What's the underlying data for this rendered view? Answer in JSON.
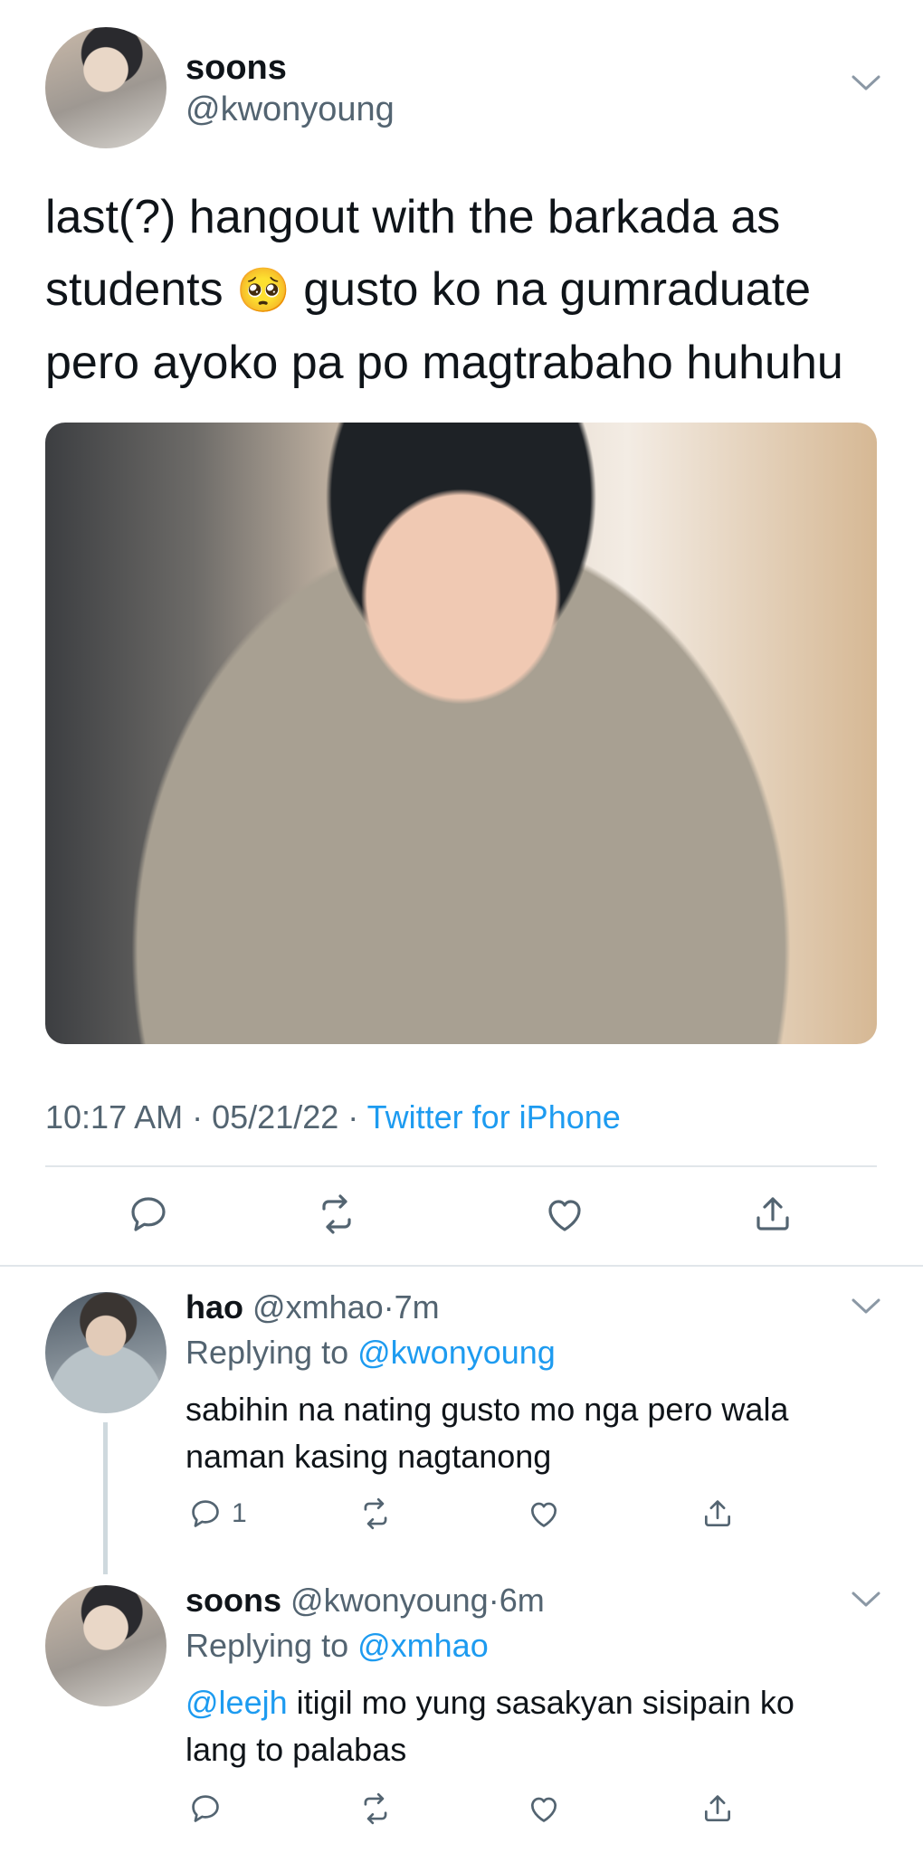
{
  "main_tweet": {
    "display_name": "soons",
    "handle": "@kwonyoung",
    "text_line1": "last(?) hangout with the barkada as",
    "text_line2_a": "students",
    "text_line2_emoji": "🥺",
    "text_line2_b": "gusto ko na gumraduate",
    "text_line3": "pero ayoko pa po magtrabaho huhuhu",
    "time": "10:17 AM",
    "date": "05/21/22",
    "separator": "·",
    "source": "Twitter for iPhone"
  },
  "replies": [
    {
      "display_name": "hao",
      "handle": "@xmhao",
      "dot": "·",
      "time": "7m",
      "replying_prefix": "Replying to",
      "replying_to": "@kwonyoung",
      "mention": "",
      "text_line1": "sabihin na nating gusto mo nga pero wala",
      "text_line2": "naman kasing nagtanong",
      "reply_count": "1"
    },
    {
      "display_name": "soons",
      "handle": "@kwonyoung",
      "dot": "·",
      "time": "6m",
      "replying_prefix": "Replying to",
      "replying_to": "@xmhao",
      "mention": "@leejh",
      "text_line1_rest": " itigil mo yung sasakyan sisipain ko",
      "text_line2": "lang to palabas",
      "reply_count": ""
    }
  ],
  "icons": {
    "reply": "reply-icon",
    "retweet": "retweet-icon",
    "like": "like-icon",
    "share": "share-icon",
    "more": "chevron-down-icon"
  },
  "colors": {
    "link": "#1d9bf0",
    "secondary_text": "#536471",
    "divider": "#e1e6ea"
  }
}
